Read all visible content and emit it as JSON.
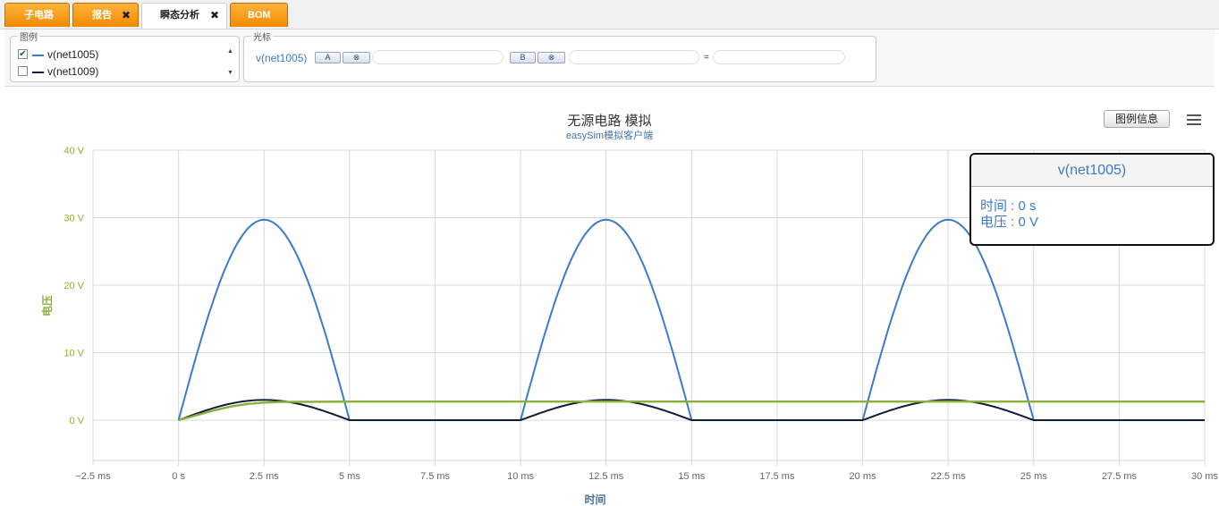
{
  "tabs": [
    {
      "label": "子电路",
      "closable": false,
      "active": false
    },
    {
      "label": "报告",
      "closable": true,
      "active": false
    },
    {
      "label": "瞬态分析",
      "closable": true,
      "active": true
    },
    {
      "label": "BOM",
      "closable": false,
      "active": false
    }
  ],
  "legend_panel": {
    "title": "图例",
    "items": [
      {
        "label": "v(net1005)",
        "checked": true,
        "color": "#3b7bc9"
      },
      {
        "label": "v(net1009)",
        "checked": false,
        "color": "#0f1f3c"
      }
    ]
  },
  "cursor_panel": {
    "title": "光标",
    "signal": "v(net1005)",
    "a_label": "A",
    "b_label": "B",
    "clear_symbol": "⊗",
    "equals": "="
  },
  "chart": {
    "title": "无源电路 模拟",
    "subtitle": "easySim模拟客户端",
    "info_button": "图例信息",
    "tooltip": {
      "series": "v(net1005)",
      "time_line": "时间 : 0 s",
      "voltage_line": "电压 : 0 V"
    }
  },
  "chart_data": {
    "type": "line",
    "title": "无源电路 模拟",
    "subtitle": "easySim模拟客户端",
    "xlabel": "时间",
    "ylabel": "电压",
    "x_unit": "ms",
    "y_unit": "V",
    "xlim": [
      -2.5,
      30
    ],
    "ylim": [
      -6,
      40
    ],
    "x_ticks": [
      "−2.5 ms",
      "0 s",
      "2.5 ms",
      "5 ms",
      "7.5 ms",
      "10 ms",
      "12.5 ms",
      "15 ms",
      "17.5 ms",
      "20 ms",
      "22.5 ms",
      "25 ms",
      "27.5 ms",
      "30 ms"
    ],
    "y_ticks": [
      "0 V",
      "10 V",
      "20 V",
      "30 V",
      "40 V"
    ],
    "grid": true,
    "series": [
      {
        "color": "#3b7bc9",
        "x": [
          0,
          0.5,
          1.0,
          1.5,
          2.0,
          2.5,
          3.0,
          3.5,
          4.0,
          4.5,
          5.0,
          10.0,
          10.5,
          11.0,
          11.5,
          12.0,
          12.5,
          13.0,
          13.5,
          14.0,
          14.5,
          15.0,
          20.0,
          20.5,
          21.0,
          21.5,
          22.0,
          22.5,
          23.0,
          23.5,
          24.0,
          24.5,
          25.0,
          30.0
        ],
        "y": [
          0,
          9.2,
          17.4,
          24.0,
          28.2,
          29.7,
          28.2,
          24.0,
          17.4,
          9.2,
          0,
          0,
          9.2,
          17.4,
          24.0,
          28.2,
          29.7,
          28.2,
          24.0,
          17.4,
          9.2,
          0,
          0,
          9.2,
          17.4,
          24.0,
          28.2,
          29.7,
          28.2,
          24.0,
          17.4,
          9.2,
          0,
          0
        ]
      },
      {
        "color": "#0f1f3c",
        "x": [
          0,
          0.5,
          1.0,
          1.5,
          2.0,
          2.5,
          3.0,
          3.5,
          4.0,
          4.5,
          5.0,
          10.0,
          10.5,
          11.0,
          11.5,
          12.0,
          12.5,
          13.0,
          13.5,
          14.0,
          14.5,
          15.0,
          20.0,
          20.5,
          21.0,
          21.5,
          22.0,
          22.5,
          23.0,
          23.5,
          24.0,
          24.5,
          25.0,
          30.0
        ],
        "y": [
          0,
          0.9,
          1.7,
          2.4,
          2.8,
          3.0,
          2.8,
          2.4,
          1.7,
          0.9,
          0,
          0,
          0.9,
          1.7,
          2.4,
          2.8,
          3.0,
          2.8,
          2.4,
          1.7,
          0.9,
          0,
          0,
          0.9,
          1.7,
          2.4,
          2.8,
          3.0,
          2.8,
          2.4,
          1.7,
          0.9,
          0,
          0
        ]
      },
      {
        "color": "#8bb03a",
        "x": [
          0,
          0.5,
          1.0,
          1.5,
          2.0,
          2.5,
          3.0,
          5.0,
          10.0,
          15.0,
          20.0,
          25.0,
          30.0
        ],
        "y": [
          0,
          0.7,
          1.4,
          2.0,
          2.4,
          2.6,
          2.7,
          2.75,
          2.75,
          2.75,
          2.75,
          2.75,
          2.75
        ]
      }
    ]
  }
}
